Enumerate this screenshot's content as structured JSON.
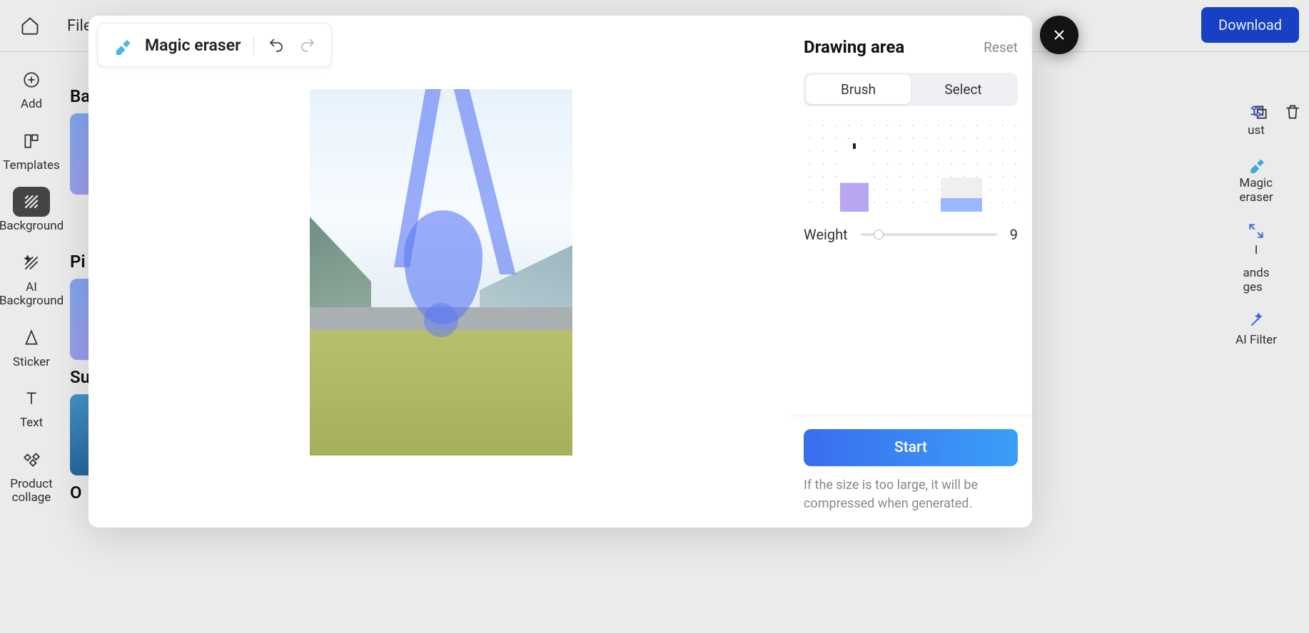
{
  "app": {
    "file_menu": "File",
    "download_label": "Download"
  },
  "left_rail": [
    {
      "label": "Add"
    },
    {
      "label": "Templates"
    },
    {
      "label": "Background"
    },
    {
      "label": "AI\nBackground"
    },
    {
      "label": "Sticker"
    },
    {
      "label": "Text"
    },
    {
      "label": "Product\ncollage"
    }
  ],
  "mid_headers": {
    "a": "Ba",
    "b": "Pi",
    "c": "Su",
    "d": "O"
  },
  "right_props": [
    {
      "label": "ust"
    },
    {
      "label": "Magic\neraser"
    },
    {
      "label": "I"
    },
    {
      "label": "ands\nges"
    },
    {
      "label": "AI Filter"
    }
  ],
  "modal": {
    "tool_title": "Magic eraser",
    "panel_title": "Drawing area",
    "reset": "Reset",
    "tab_brush": "Brush",
    "tab_select": "Select",
    "weight_label": "Weight",
    "weight_value": "9",
    "start": "Start",
    "hint": "If the size is too large, it will be compressed when generated."
  }
}
